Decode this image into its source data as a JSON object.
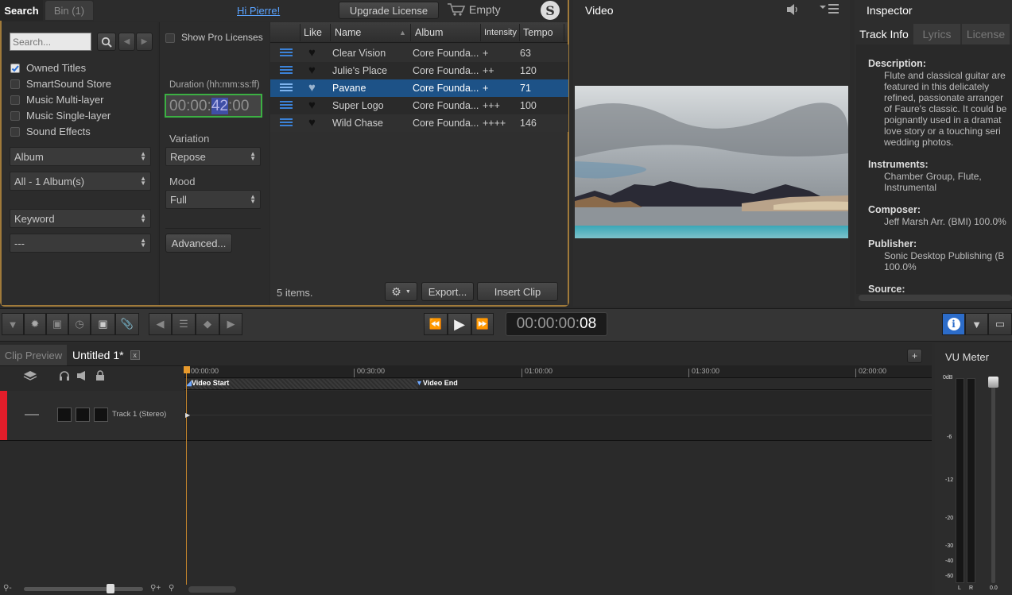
{
  "tabs": {
    "search": "Search",
    "bin": "Bin (1)"
  },
  "user_greeting": "Hi Pierre!",
  "upgrade_label": "Upgrade License",
  "cart_label": "Empty",
  "search": {
    "placeholder": "Search..."
  },
  "show_pro_label": "Show Pro Licenses",
  "filters": [
    {
      "label": "Owned Titles",
      "checked": true
    },
    {
      "label": "SmartSound Store",
      "checked": false
    },
    {
      "label": "Music Multi-layer",
      "checked": false
    },
    {
      "label": "Music Single-layer",
      "checked": false
    },
    {
      "label": "Sound Effects",
      "checked": false
    }
  ],
  "combos": {
    "album": "Album",
    "album_value": "All - 1 Album(s)",
    "keyword": "Keyword",
    "keyword_value": "---"
  },
  "duration": {
    "label": "Duration (hh:mm:ss:ff)",
    "pre": "00:00:",
    "sel": "42",
    "post": ":00"
  },
  "variation": {
    "label": "Variation",
    "value": "Repose"
  },
  "mood": {
    "label": "Mood",
    "value": "Full"
  },
  "advanced_label": "Advanced...",
  "table": {
    "headers": [
      "Like",
      "Name",
      "Album",
      "Intensity",
      "Tempo"
    ],
    "rows": [
      {
        "name": "Clear Vision",
        "album": "Core Founda...",
        "intensity": "+",
        "tempo": "63",
        "selected": false
      },
      {
        "name": "Julie's Place",
        "album": "Core Founda...",
        "intensity": "++",
        "tempo": "120",
        "selected": false
      },
      {
        "name": "Pavane",
        "album": "Core Founda...",
        "intensity": "+",
        "tempo": "71",
        "selected": true
      },
      {
        "name": "Super Logo",
        "album": "Core Founda...",
        "intensity": "+++",
        "tempo": "100",
        "selected": false
      },
      {
        "name": "Wild Chase",
        "album": "Core Founda...",
        "intensity": "++++",
        "tempo": "146",
        "selected": false
      }
    ]
  },
  "items_count": "5 items.",
  "export_label": "Export...",
  "insert_label": "Insert Clip",
  "video_title": "Video",
  "inspector": {
    "title": "Inspector",
    "tabs": [
      "Track Info",
      "Lyrics",
      "License"
    ],
    "desc_label": "Description:",
    "desc_lines": [
      "Flute and classical guitar are",
      "featured in this delicately",
      "refined, passionate arranger",
      "of Faure's classic. It could be",
      "poignantly used in a dramat",
      "love story or a touching seri",
      "wedding photos."
    ],
    "instr_label": "Instruments:",
    "instr_lines": [
      "Chamber Group, Flute,",
      "Instrumental"
    ],
    "comp_label": "Composer:",
    "comp_value": "Jeff Marsh Arr. (BMI) 100.0%",
    "pub_label": "Publisher:",
    "pub_lines": [
      "Sonic Desktop Publishing (B",
      "100.0%"
    ],
    "source_label": "Source:"
  },
  "timecode": {
    "main": "00:00:00:",
    "frames": "08"
  },
  "timeline": {
    "tabs": {
      "preview": "Clip Preview",
      "doc": "Untitled 1*",
      "close": "x"
    },
    "ruler": [
      "00:00:00",
      "00:30:00",
      "01:00:00",
      "01:30:00",
      "02:00:00"
    ],
    "markers": {
      "start": "Video Start",
      "end": "Video End"
    },
    "track_name": "Track 1 (Stereo)"
  },
  "vu": {
    "title": "VU Meter",
    "scale": [
      "0dB",
      "-6",
      "-12",
      "-20",
      "-30",
      "-40",
      "-60"
    ],
    "channels": [
      "L",
      "R"
    ],
    "value": "0.0"
  }
}
